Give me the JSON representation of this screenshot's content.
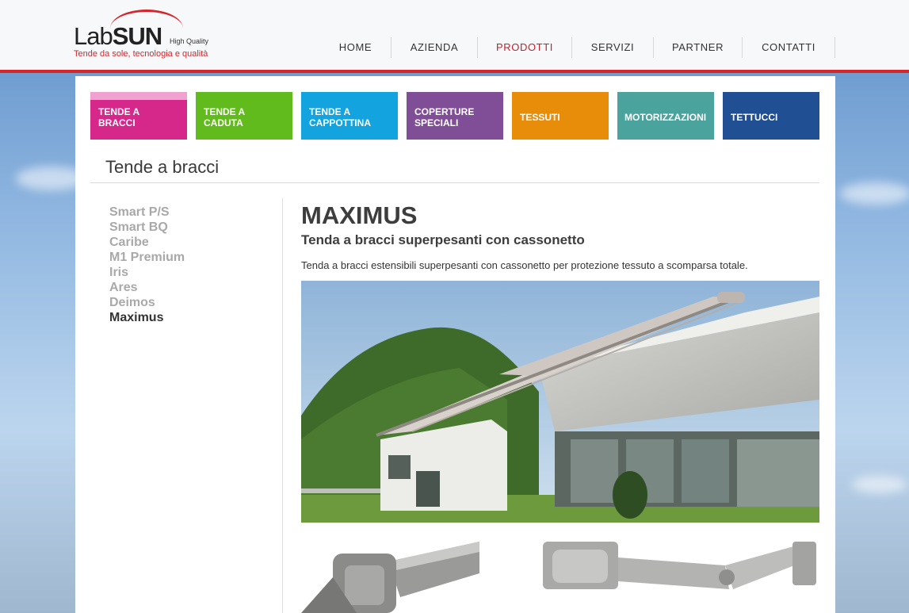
{
  "logo": {
    "word_light": "Lab",
    "word_bold": "SUN",
    "quality": "High Quality",
    "tagline": "Tende da sole, tecnologia e qualità"
  },
  "nav": {
    "items": [
      "HOME",
      "AZIENDA",
      "PRODOTTI",
      "SERVIZI",
      "PARTNER",
      "CONTATTI"
    ],
    "active": "PRODOTTI"
  },
  "categories": [
    {
      "line1": "TENDE A",
      "line2": "BRACCI",
      "color": "#d6278b"
    },
    {
      "line1": "TENDE A",
      "line2": "CADUTA",
      "color": "#62bb1c"
    },
    {
      "line1": "TENDE A",
      "line2": "CAPPOTTINA",
      "color": "#13a3df"
    },
    {
      "line1": "COPERTURE",
      "line2": "SPECIALI",
      "color": "#7f4e96"
    },
    {
      "line1": "",
      "line2": "TESSUTI",
      "color": "#e88d0a"
    },
    {
      "line1": "",
      "line2": "MOTORIZZAZIONI",
      "color": "#4aa39d"
    },
    {
      "line1": "",
      "line2": "TETTUCCI",
      "color": "#204f94"
    }
  ],
  "section": {
    "title": "Tende a bracci"
  },
  "sidebar": {
    "items": [
      "Smart P/S",
      "Smart BQ",
      "Caribe",
      "M1 Premium",
      "Iris",
      "Ares",
      "Deimos",
      "Maximus"
    ],
    "current": "Maximus"
  },
  "product": {
    "name": "MAXIMUS",
    "subtitle": "Tenda a bracci superpesanti con cassonetto",
    "description": "Tenda a bracci estensibili superpesanti con cassonetto per protezione tessuto a scomparsa totale."
  },
  "colors": {
    "accent": "#d6262b",
    "active_nav": "#c0222a"
  }
}
